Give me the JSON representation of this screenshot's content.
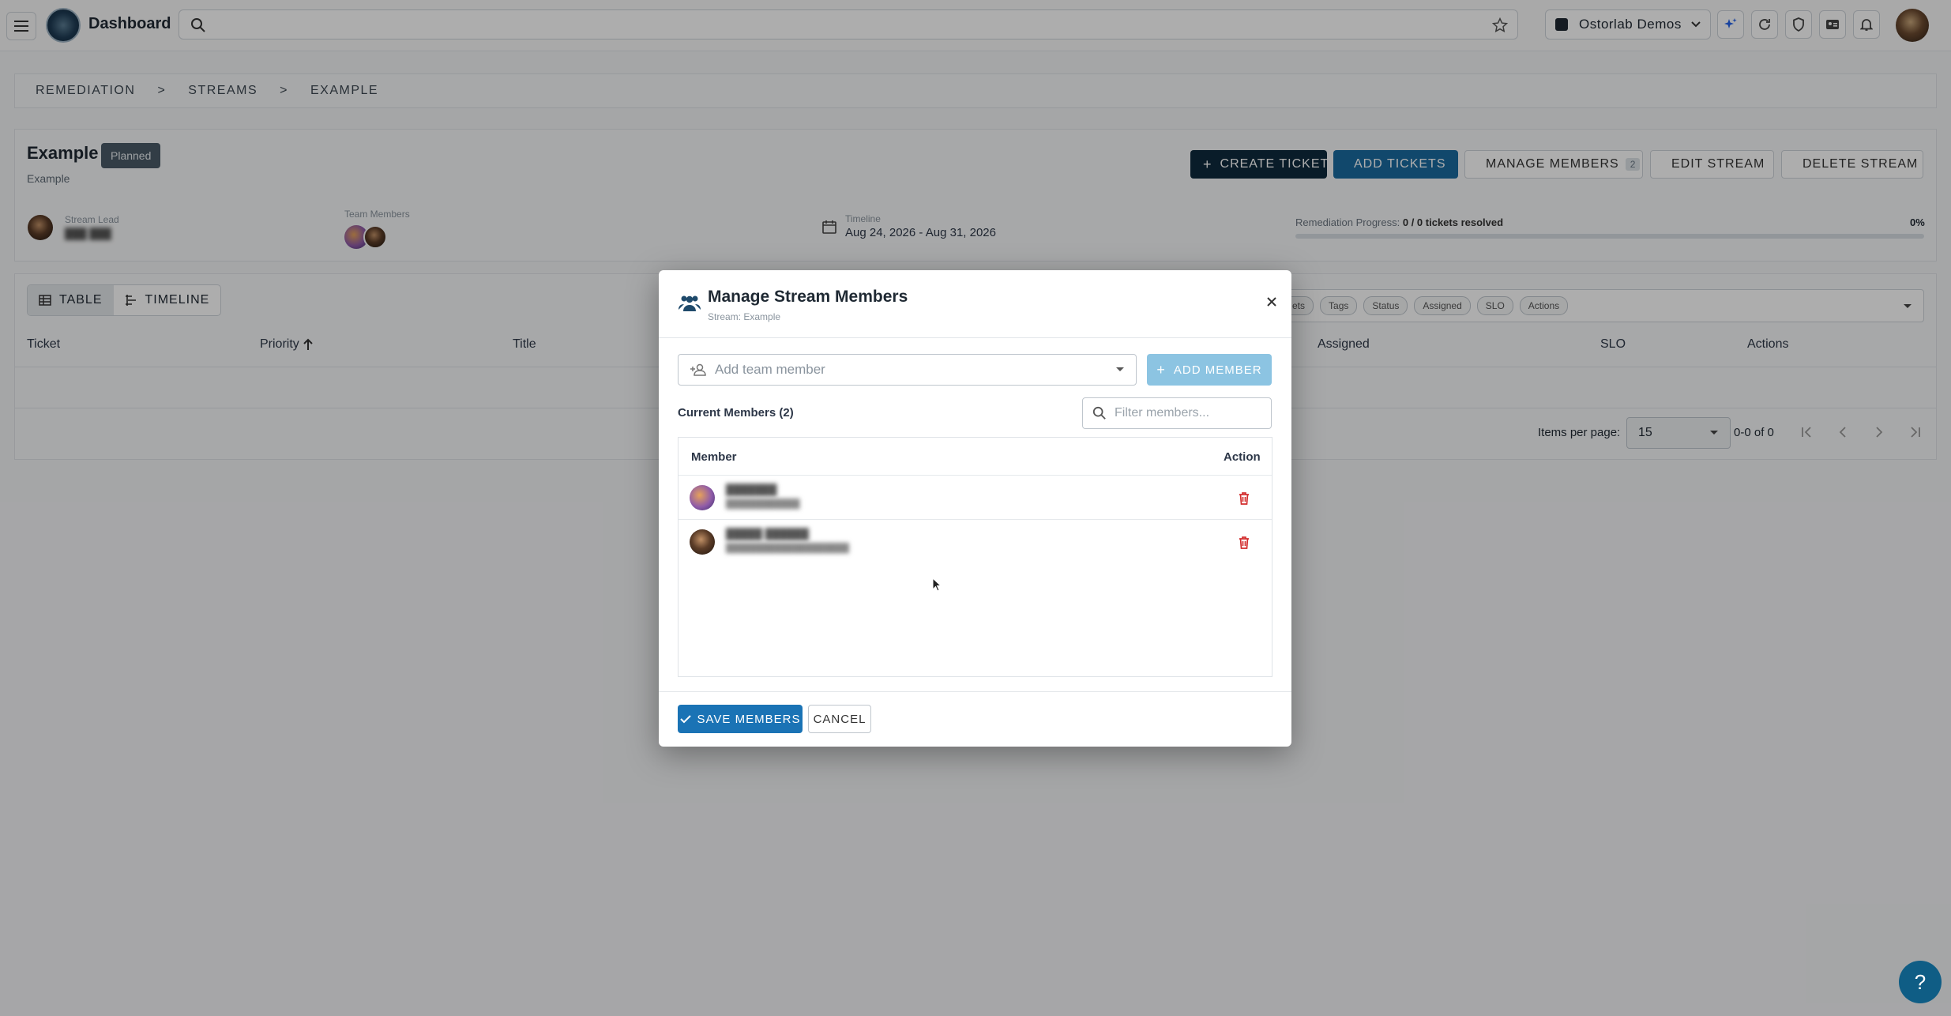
{
  "topbar": {
    "brand": "Dashboard",
    "org": "Ostorlab Demos"
  },
  "breadcrumb": [
    "REMEDIATION",
    "STREAMS",
    "EXAMPLE"
  ],
  "stream": {
    "title": "Example",
    "status": "Planned",
    "subtitle": "Example",
    "buttons": {
      "create_ticket": "CREATE TICKET",
      "add_tickets": "ADD TICKETS",
      "manage_members": "MANAGE MEMBERS",
      "manage_members_count": "2",
      "edit_stream": "EDIT STREAM",
      "delete_stream": "DELETE STREAM"
    },
    "lead_label": "Stream Lead",
    "lead_name": "███ ███",
    "team_label": "Team Members",
    "timeline_label": "Timeline",
    "timeline_value": "Aug 24, 2026 - Aug 31, 2026",
    "progress_label": "Remediation Progress:",
    "progress_value": "0 / 0 tickets resolved",
    "progress_percent": "0%",
    "progress_fraction": 0
  },
  "table": {
    "view_table": "TABLE",
    "view_timeline": "TIMELINE",
    "column_chips": [
      "ets",
      "Tags",
      "Status",
      "Assigned",
      "SLO",
      "Actions"
    ],
    "headers": {
      "ticket": "Ticket",
      "priority": "Priority",
      "title": "Title",
      "assigned": "Assigned",
      "slo": "SLO",
      "actions": "Actions"
    },
    "items_per_page_label": "Items per page:",
    "items_per_page": "15",
    "range": "0-0 of 0"
  },
  "modal": {
    "title": "Manage Stream Members",
    "subtitle": "Stream: Example",
    "add_placeholder": "Add team member",
    "add_button": "ADD MEMBER",
    "current_members": "Current Members (2)",
    "filter_placeholder": "Filter members...",
    "col_member": "Member",
    "col_action": "Action",
    "members": [
      {
        "name": "███████",
        "email": "████████████"
      },
      {
        "name": "█████ ██████",
        "email": "████████████████████"
      }
    ],
    "save": "SAVE MEMBERS",
    "cancel": "CANCEL"
  },
  "help": "?"
}
